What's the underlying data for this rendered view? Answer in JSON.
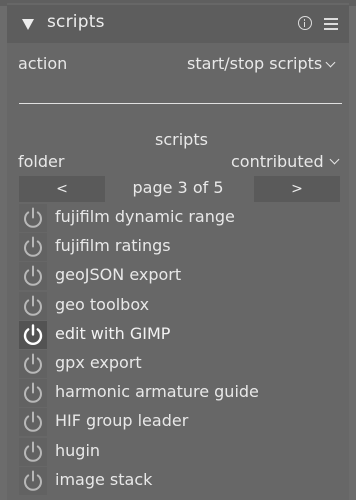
{
  "header": {
    "title": "scripts"
  },
  "action": {
    "label": "action",
    "value": "start/stop scripts"
  },
  "scripts_section": {
    "heading": "scripts",
    "folder_label": "folder",
    "folder_value": "contributed",
    "prev_label": "<",
    "next_label": ">",
    "page_label": "page 3 of 5"
  },
  "scripts": [
    {
      "name": "fujifilm dynamic range",
      "active": false
    },
    {
      "name": "fujifilm ratings",
      "active": false
    },
    {
      "name": "geoJSON export",
      "active": false
    },
    {
      "name": "geo toolbox",
      "active": false
    },
    {
      "name": "edit with GIMP",
      "active": true
    },
    {
      "name": "gpx export",
      "active": false
    },
    {
      "name": "harmonic armature guide",
      "active": false
    },
    {
      "name": "HIF group leader",
      "active": false
    },
    {
      "name": "hugin",
      "active": false
    },
    {
      "name": "image stack",
      "active": false
    }
  ],
  "colors": {
    "panel_bg": "#676767",
    "header_bg": "#5d5d5d",
    "text": "#e8e8e8",
    "icon_inactive": "#b8b8b8",
    "icon_active": "#ffffff"
  }
}
